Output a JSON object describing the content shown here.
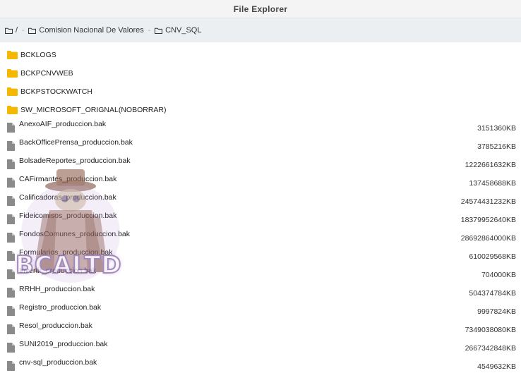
{
  "window": {
    "title": "File Explorer"
  },
  "breadcrumb": [
    {
      "label": "/"
    },
    {
      "label": "Comision Nacional De Valores"
    },
    {
      "label": "CNV_SQL"
    }
  ],
  "folders": [
    {
      "name": "BCKLOGS"
    },
    {
      "name": "BCKPCNVWEB"
    },
    {
      "name": "BCKPSTOCKWATCH"
    },
    {
      "name": "SW_MICROSOFT_ORIGNAL(NOBORRAR)"
    }
  ],
  "files": [
    {
      "name": "AnexoAIF_produccion.bak",
      "size": "3151360KB"
    },
    {
      "name": "BackOfficePrensa_produccion.bak",
      "size": "3785216KB"
    },
    {
      "name": "BolsadeReportes_produccion.bak",
      "size": "1222661632KB"
    },
    {
      "name": "CAFirmantes_produccion.bak",
      "size": "137458688KB"
    },
    {
      "name": "Calificadoras_produccion.bak",
      "size": "24574431232KB"
    },
    {
      "name": "Fideicomisos_produccion.bak",
      "size": "18379952640KB"
    },
    {
      "name": "FondosComunes_produccion.bak",
      "size": "28692864000KB"
    },
    {
      "name": "Formularios_produccion.bak",
      "size": "610029568KB"
    },
    {
      "name": "Invertir_produccion.bak",
      "size": "704000KB"
    },
    {
      "name": "RRHH_produccion.bak",
      "size": "504374784KB"
    },
    {
      "name": "Registro_produccion.bak",
      "size": "9997824KB"
    },
    {
      "name": "Resol_produccion.bak",
      "size": "7349038080KB"
    },
    {
      "name": "SUNI2019_produccion.bak",
      "size": "2667342848KB"
    },
    {
      "name": "cnv-sql_produccion.bak",
      "size": "4549632KB"
    }
  ],
  "watermark": {
    "text": "BCALTD"
  },
  "colors": {
    "folder": "#f5b800",
    "file": "#8a8a8a",
    "accent": "#8a6aa8"
  }
}
